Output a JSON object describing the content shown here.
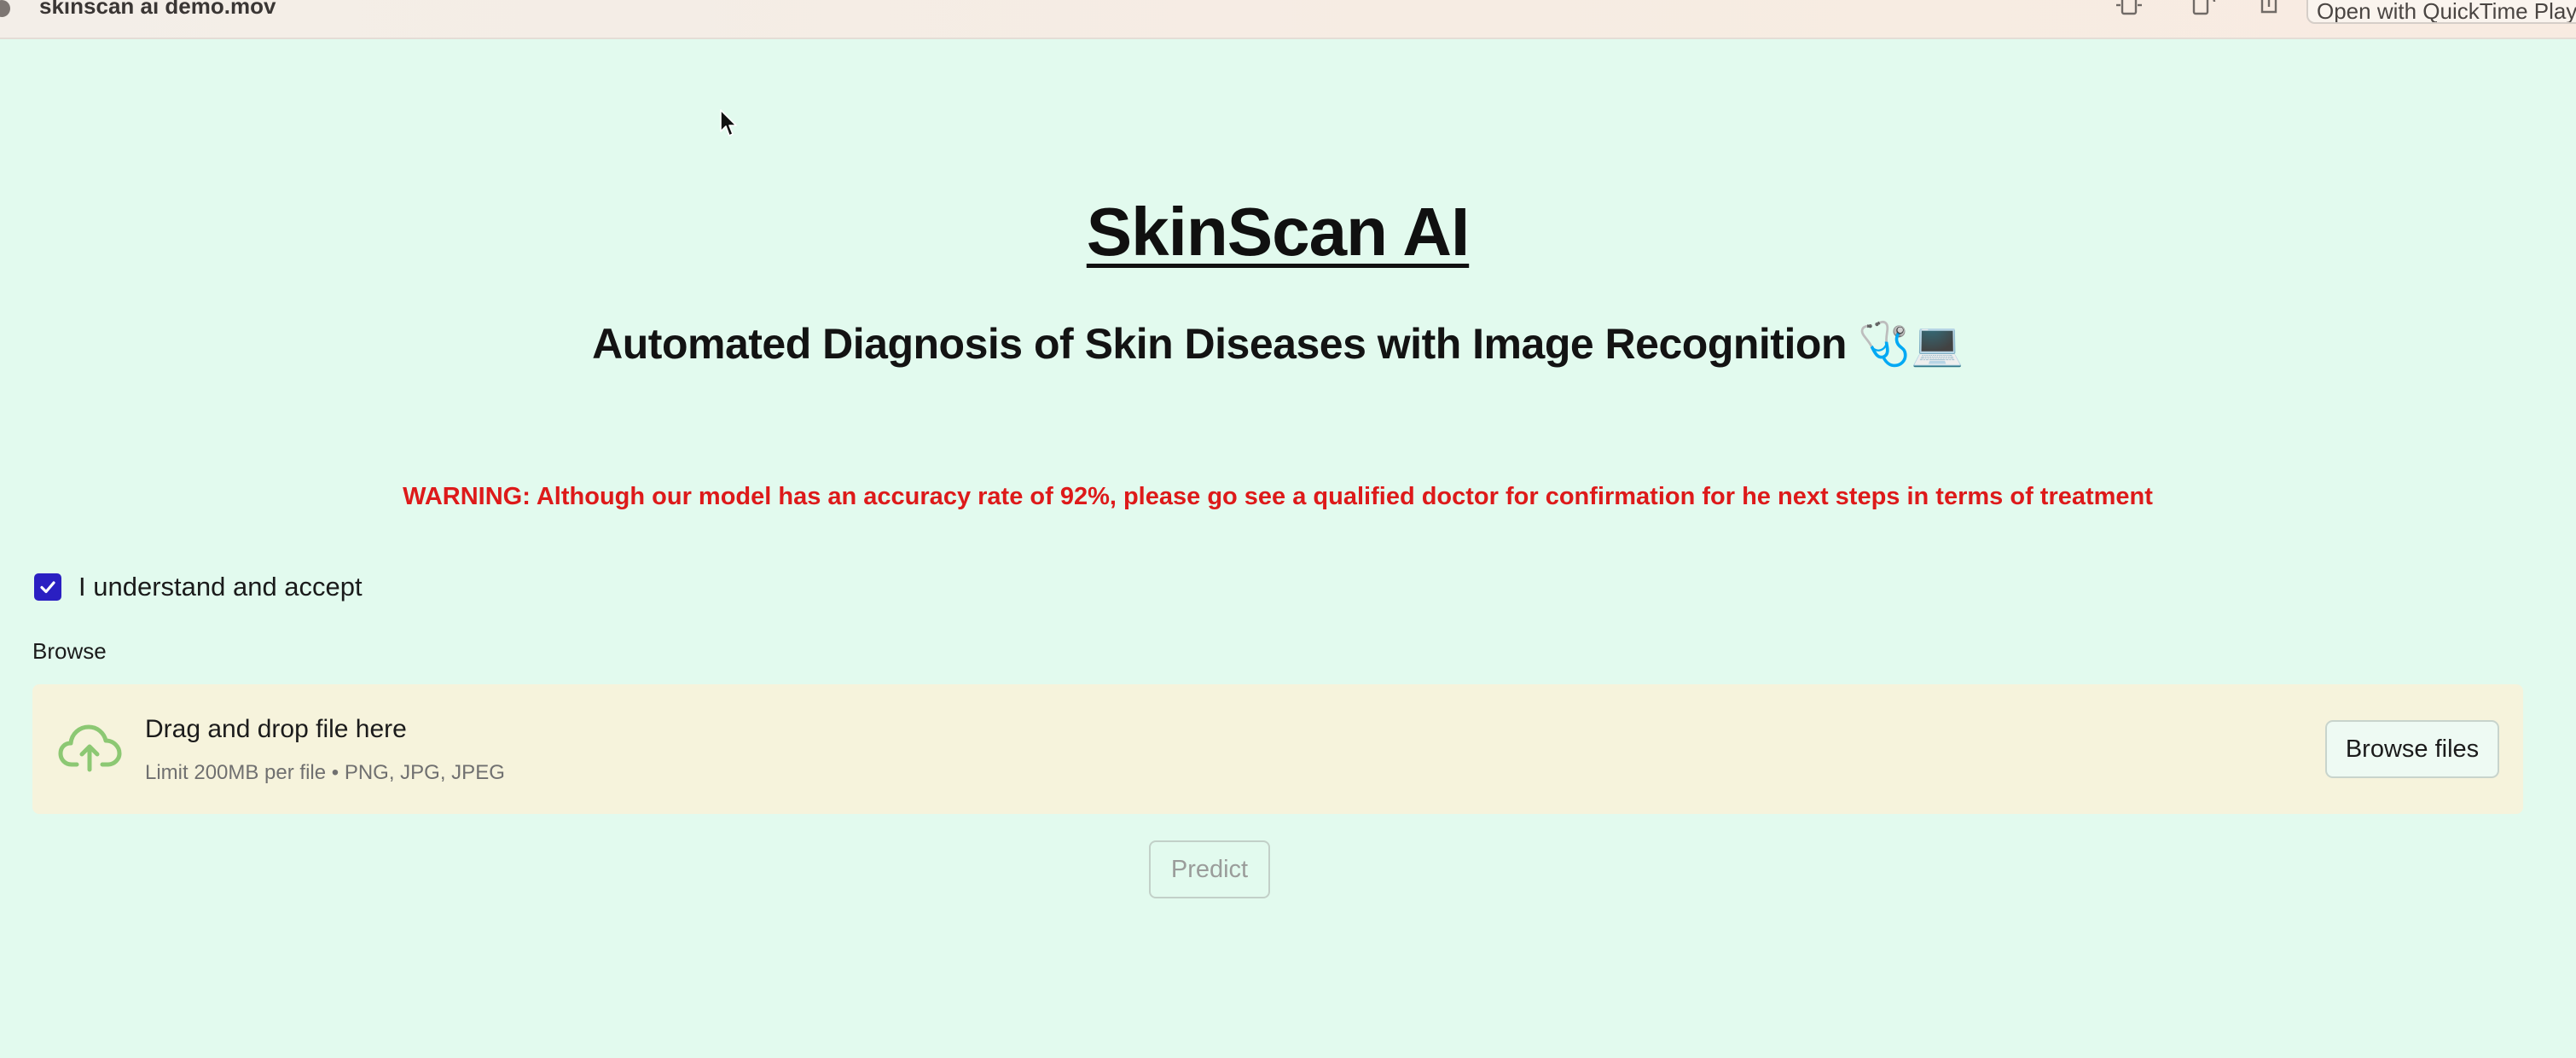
{
  "window": {
    "title": "skinscan ai demo.mov",
    "open_with_label": "Open with QuickTime Player"
  },
  "app": {
    "title": "SkinScan AI",
    "subtitle": "Automated Diagnosis of Skin Diseases with Image Recognition 🩺💻",
    "warning": "WARNING: Although our model has an accuracy rate of 92%, please go see a qualified doctor for confirmation for he next steps in terms of treatment",
    "warning_color": "#dd1a1a"
  },
  "consent": {
    "label": "I understand and accept",
    "checked": true,
    "checkbox_color": "#2a1fc2"
  },
  "uploader": {
    "label": "Browse",
    "drop_text": "Drag and drop file here",
    "limit_text": "Limit 200MB per file • PNG, JPG, JPEG",
    "browse_button": "Browse files",
    "icon": "cloud-upload-icon",
    "icon_color": "#8cc873",
    "background": "#f6f3dc"
  },
  "predict_button": "Predict",
  "page_background": "#e2faee"
}
